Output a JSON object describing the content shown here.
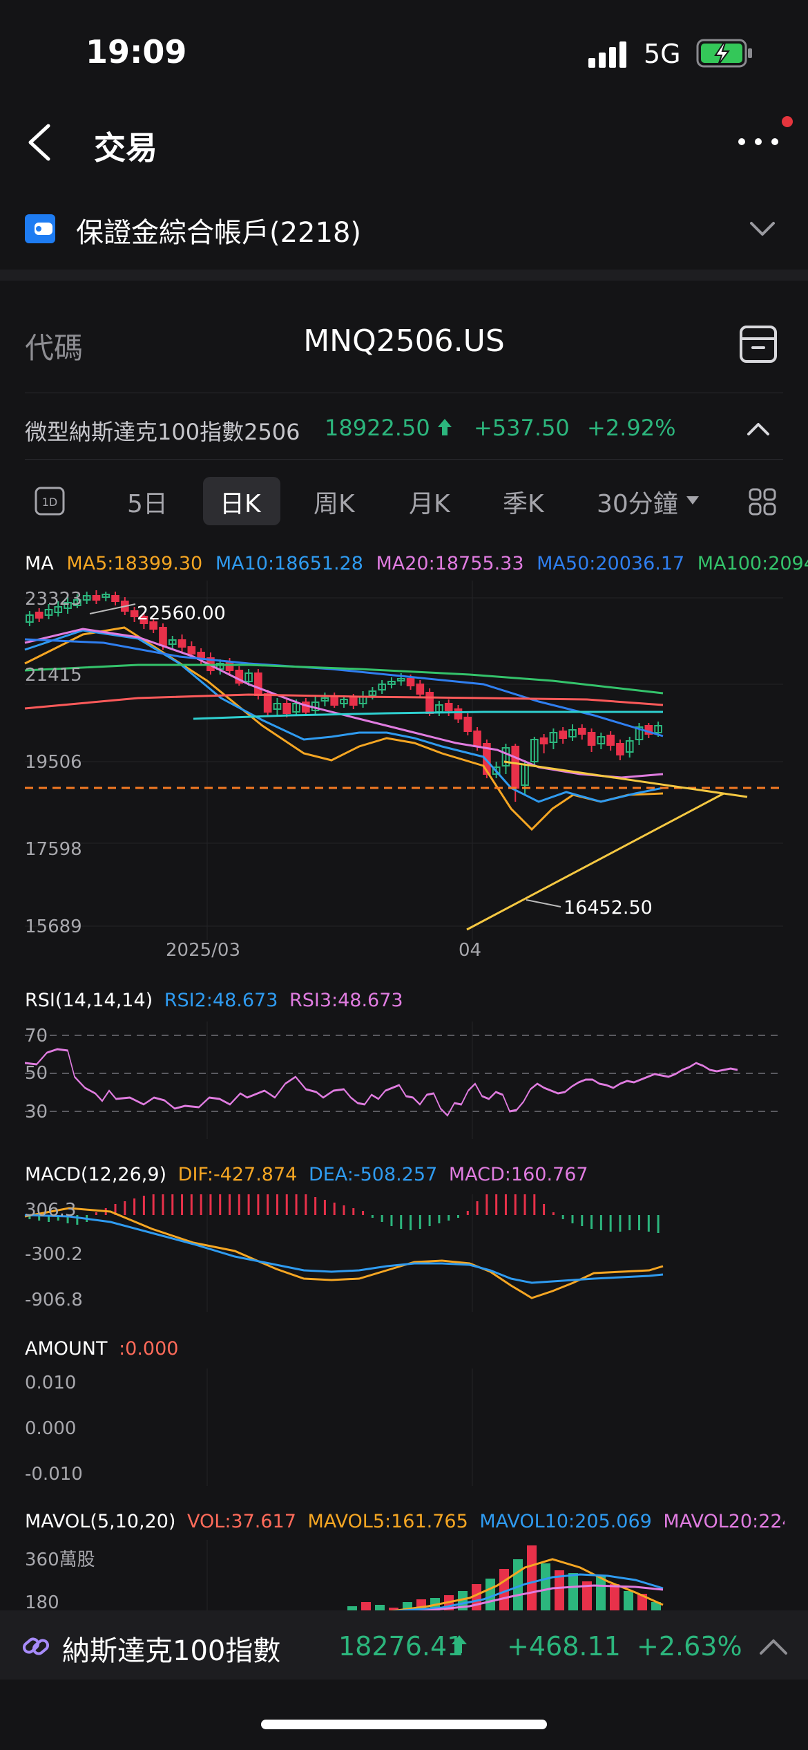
{
  "status": {
    "time": "19:09",
    "network": "5G"
  },
  "header": {
    "title": "交易"
  },
  "account": {
    "name": "保證金綜合帳戶(2218)"
  },
  "code_row": {
    "label": "代碼",
    "symbol": "MNQ2506.US"
  },
  "quote": {
    "name": "微型納斯達克100指數2506",
    "price": "18922.50",
    "change": "+537.50",
    "percent": "+2.92%"
  },
  "tabs": {
    "t1d": "1D",
    "t5": "5日",
    "tday": "日K",
    "tweek": "周K",
    "tmonth": "月K",
    "tquarter": "季K",
    "tmin": "30分鐘"
  },
  "ma": {
    "label": "MA",
    "ma5": "MA5:18399.30",
    "ma10": "MA10:18651.28",
    "ma20": "MA20:18755.33",
    "ma50": "MA50:20036.17",
    "ma100": "MA100:2094"
  },
  "price_axis": {
    "y1": "23323",
    "y2": "21415",
    "y3": "19506",
    "y4": "17598",
    "y5": "15689",
    "x1": "2025/03",
    "x2": "04",
    "high": "22560.00",
    "low": "16452.50"
  },
  "rsi": {
    "label": "RSI(14,14,14)",
    "rsi2": "RSI2:48.673",
    "rsi3": "RSI3:48.673",
    "y70": "70",
    "y50": "50",
    "y30": "30"
  },
  "macd": {
    "label": "MACD(12,26,9)",
    "dif": "DIF:-427.874",
    "dea": "DEA:-508.257",
    "macd": "MACD:160.767",
    "y1": "306.3",
    "y2": "-300.2",
    "y3": "-906.8"
  },
  "amount": {
    "label": "AMOUNT",
    "value": ":0.000",
    "y1": "0.010",
    "y2": "0.000",
    "y3": "-0.010"
  },
  "mavol": {
    "label": "MAVOL(5,10,20)",
    "vol": "VOL:37.617",
    "m5": "MAVOL5:161.765",
    "m10": "MAVOL10:205.069",
    "m20": "MAVOL20:224",
    "y1": "360萬股",
    "y2": "180"
  },
  "footer": {
    "name": "納斯達克100指數",
    "price": "18276.41",
    "change": "+468.11",
    "percent": "+2.63%"
  },
  "colors": {
    "green": "#2cb67d",
    "red": "#e8314a",
    "orange": "#f5a623",
    "blue": "#2f9bf0",
    "pink": "#e07ce0",
    "ma50": "#2f7ff0",
    "ma100": "#34c36b"
  }
}
